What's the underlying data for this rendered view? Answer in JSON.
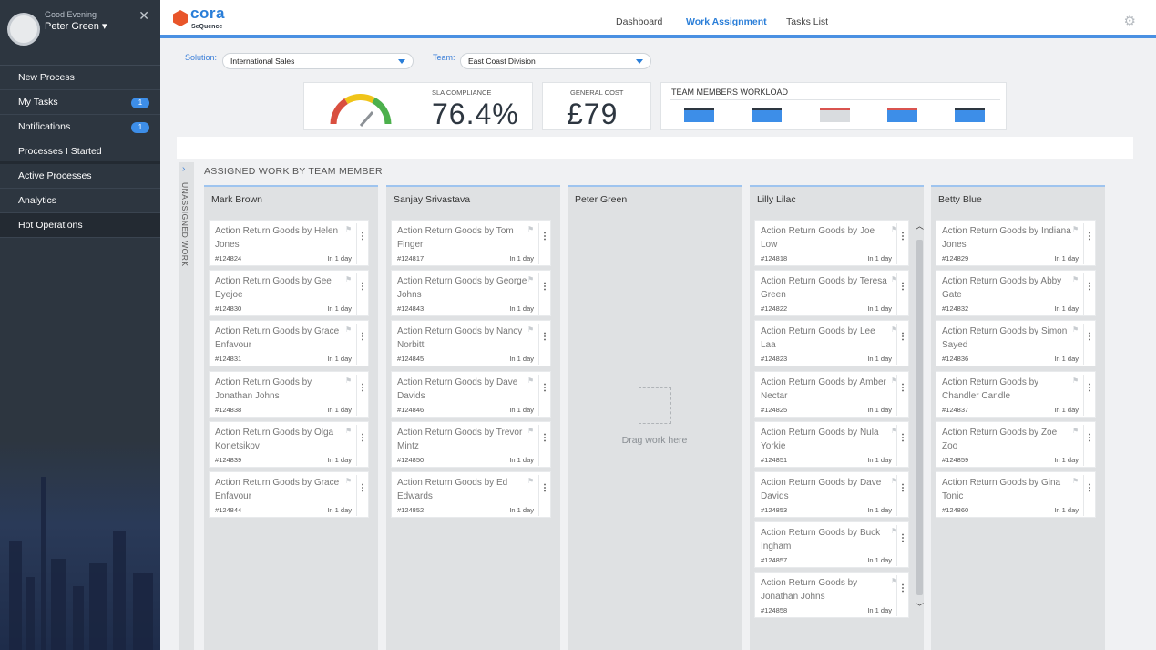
{
  "sidebar": {
    "greeting": "Good Evening",
    "user_name": "Peter Green ▾",
    "close": "✕",
    "items": [
      {
        "label": "New Process",
        "badge": null
      },
      {
        "label": "My Tasks",
        "badge": "1"
      },
      {
        "label": "Notifications",
        "badge": "1"
      },
      {
        "label": "Processes I Started",
        "badge": null
      },
      {
        "label": "Active Processes",
        "badge": null
      },
      {
        "label": "Analytics",
        "badge": null
      },
      {
        "label": "Hot Operations",
        "badge": null
      }
    ]
  },
  "header": {
    "logo": "cora",
    "logo_sub": "SeQuence",
    "nav": [
      "Dashboard",
      "Work Assignment",
      "Tasks List"
    ],
    "active_nav": "Work Assignment",
    "settings_icon": "gear-icon"
  },
  "filters": {
    "solution_label": "Solution:",
    "solution_value": "International Sales",
    "team_label": "Team:",
    "team_value": "East Coast Division"
  },
  "kpis": {
    "sla_label": "SLA COMPLIANCE",
    "sla_value": "76.4%",
    "cost_label": "GENERAL COST",
    "cost_value": "£79",
    "workload_label": "TEAM MEMBERS WORKLOAD"
  },
  "board": {
    "unassigned_label": "UNASSIGNED WORK",
    "title": "ASSIGNED WORK BY TEAM MEMBER",
    "drag_text": "Drag work here",
    "columns": [
      {
        "name": "Mark Brown",
        "tasks": [
          {
            "title": "Action Return Goods by Helen Jones",
            "id": "#124824",
            "due": "In 1 day"
          },
          {
            "title": "Action Return Goods by Gee Eyejoe",
            "id": "#124830",
            "due": "In 1 day"
          },
          {
            "title": "Action Return Goods by Grace Enfavour",
            "id": "#124831",
            "due": "In 1 day"
          },
          {
            "title": "Action Return Goods by Jonathan Johns",
            "id": "#124838",
            "due": "In 1 day"
          },
          {
            "title": "Action Return Goods by Olga Konetsikov",
            "id": "#124839",
            "due": "In 1 day"
          },
          {
            "title": "Action Return Goods by Grace Enfavour",
            "id": "#124844",
            "due": "In 1 day"
          }
        ]
      },
      {
        "name": "Sanjay Srivastava",
        "tasks": [
          {
            "title": "Action Return Goods by Tom Finger",
            "id": "#124817",
            "due": "In 1 day"
          },
          {
            "title": "Action Return Goods by George Johns",
            "id": "#124843",
            "due": "In 1 day"
          },
          {
            "title": "Action Return Goods by Nancy Norbitt",
            "id": "#124845",
            "due": "In 1 day"
          },
          {
            "title": "Action Return Goods by Dave Davids",
            "id": "#124846",
            "due": "In 1 day"
          },
          {
            "title": "Action Return Goods by Trevor Mintz",
            "id": "#124850",
            "due": "In 1 day"
          },
          {
            "title": "Action Return Goods by Ed Edwards",
            "id": "#124852",
            "due": "In 1 day"
          }
        ]
      },
      {
        "name": "Peter Green",
        "tasks": []
      },
      {
        "name": "Lilly Lilac",
        "tasks": [
          {
            "title": "Action Return Goods by Joe Low",
            "id": "#124818",
            "due": "In 1 day"
          },
          {
            "title": "Action Return Goods by Teresa Green",
            "id": "#124822",
            "due": "In 1 day"
          },
          {
            "title": "Action Return Goods by Lee Laa",
            "id": "#124823",
            "due": "In 1 day"
          },
          {
            "title": "Action Return Goods by Amber Nectar",
            "id": "#124825",
            "due": "In 1 day"
          },
          {
            "title": "Action Return Goods by Nula Yorkie",
            "id": "#124851",
            "due": "In 1 day"
          },
          {
            "title": "Action Return Goods by Dave Davids",
            "id": "#124853",
            "due": "In 1 day"
          },
          {
            "title": "Action Return Goods by Buck Ingham",
            "id": "#124857",
            "due": "In 1 day"
          },
          {
            "title": "Action Return Goods by Jonathan Johns",
            "id": "#124858",
            "due": "In 1 day"
          }
        ]
      },
      {
        "name": "Betty Blue",
        "tasks": [
          {
            "title": "Action Return Goods by Indiana Jones",
            "id": "#124829",
            "due": "In 1 day"
          },
          {
            "title": "Action Return Goods by Abby Gate",
            "id": "#124832",
            "due": "In 1 day"
          },
          {
            "title": "Action Return Goods by Simon Sayed",
            "id": "#124836",
            "due": "In 1 day"
          },
          {
            "title": "Action Return Goods by Chandler Candle",
            "id": "#124837",
            "due": "In 1 day"
          },
          {
            "title": "Action Return Goods by Zoe Zoo",
            "id": "#124859",
            "due": "In 1 day"
          },
          {
            "title": "Action Return Goods by Gina Tonic",
            "id": "#124860",
            "due": "In 1 day"
          }
        ]
      }
    ]
  },
  "colors": {
    "accent": "#2a7ed8",
    "sidebar": "#2d3640",
    "badge": "#3d8ee8",
    "logo": "#e8552a"
  }
}
